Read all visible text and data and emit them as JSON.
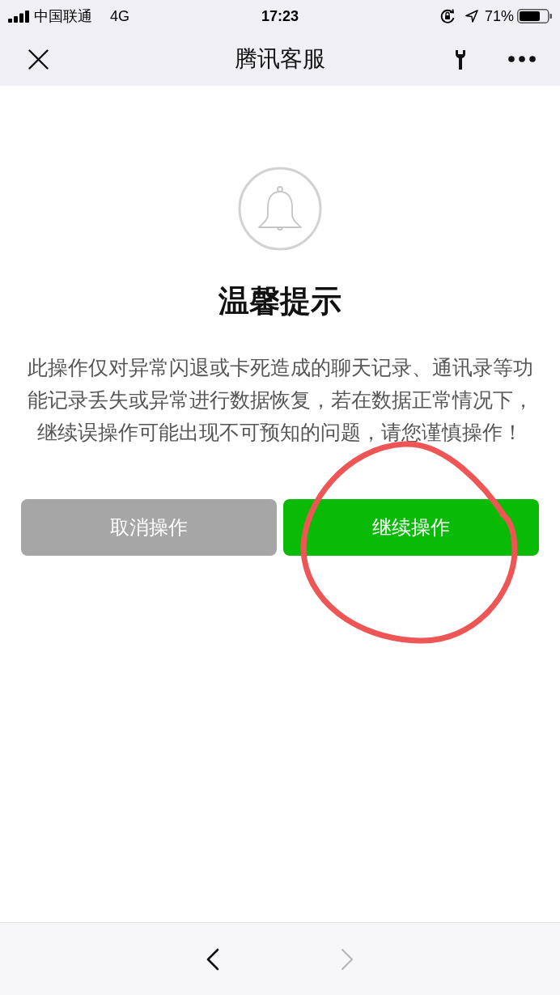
{
  "status_bar": {
    "carrier": "中国联通",
    "network": "4G",
    "time": "17:23",
    "battery": "71%"
  },
  "nav_bar": {
    "title": "腾讯客服"
  },
  "dialog": {
    "title": "温馨提示",
    "message": "此操作仅对异常闪退或卡死造成的聊天记录、通讯录等功能记录丢失或异常进行数据恢复，若在数据正常情况下，继续误操作可能出现不可预知的问题，请您谨慎操作！",
    "buttons": [
      {
        "label": "取消操作",
        "kind": "secondary"
      },
      {
        "label": "继续操作",
        "kind": "primary"
      }
    ]
  },
  "annotations": [
    {
      "kind": "circle"
    }
  ],
  "toolbar": {
    "buttons": [
      {
        "kind": "back",
        "disabled": false
      },
      {
        "kind": "forward",
        "disabled": true
      }
    ]
  }
}
